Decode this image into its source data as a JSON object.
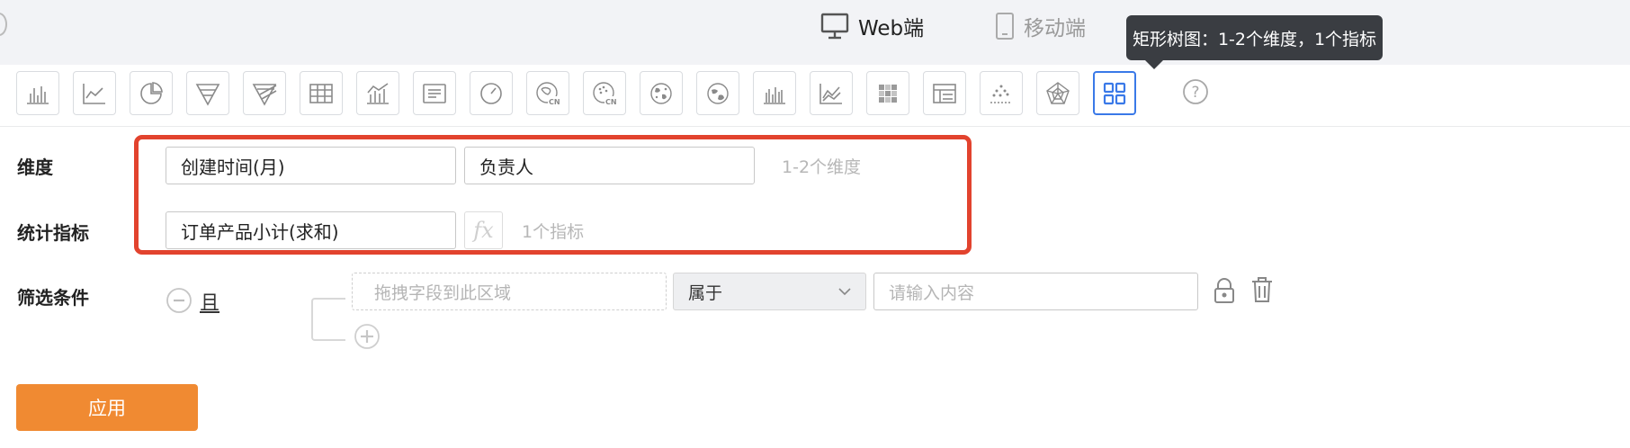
{
  "platform_switch": {
    "web_label": "Web端",
    "mobile_label": "移动端",
    "web_icon": "monitor-icon",
    "mobile_icon": "phone-icon"
  },
  "tooltip": "矩形树图：1-2个维度，1个指标",
  "chart_types": [
    {
      "icon": "bar-chart-icon"
    },
    {
      "icon": "line-chart-icon"
    },
    {
      "icon": "pie-chart-icon"
    },
    {
      "icon": "funnel-icon"
    },
    {
      "icon": "funnel-slanted-icon"
    },
    {
      "icon": "table-icon"
    },
    {
      "icon": "bar-line-combo-icon"
    },
    {
      "icon": "text-card-icon"
    },
    {
      "icon": "gauge-icon"
    },
    {
      "icon": "china-map-icon"
    },
    {
      "icon": "china-scatter-map-icon"
    },
    {
      "icon": "world-map-icon"
    },
    {
      "icon": "globe-icon"
    },
    {
      "icon": "stacked-bar-icon"
    },
    {
      "icon": "dual-line-icon"
    },
    {
      "icon": "heatmap-icon"
    },
    {
      "icon": "pivot-table-icon"
    },
    {
      "icon": "scatter-icon"
    },
    {
      "icon": "radar-icon"
    },
    {
      "icon": "treemap-icon",
      "active": true
    }
  ],
  "help_icon": "question-circle-icon",
  "dimensions": {
    "label": "维度",
    "fields": [
      "创建时间(月)",
      "负责人"
    ],
    "hint": "1-2个维度"
  },
  "metrics": {
    "label": "统计指标",
    "fields": [
      "订单产品小计(求和)"
    ],
    "fx": "fx",
    "hint": "1个指标"
  },
  "filters": {
    "label": "筛选条件",
    "and_label": "且",
    "dropzone_placeholder": "拖拽字段到此区域",
    "operator": "属于",
    "value_placeholder": "请输入内容"
  },
  "apply_label": "应用",
  "colors": {
    "accent": "#3a79e8",
    "highlight_border": "#e2432e",
    "apply_button": "#f08a32",
    "tooltip_bg": "#3a3d42"
  }
}
